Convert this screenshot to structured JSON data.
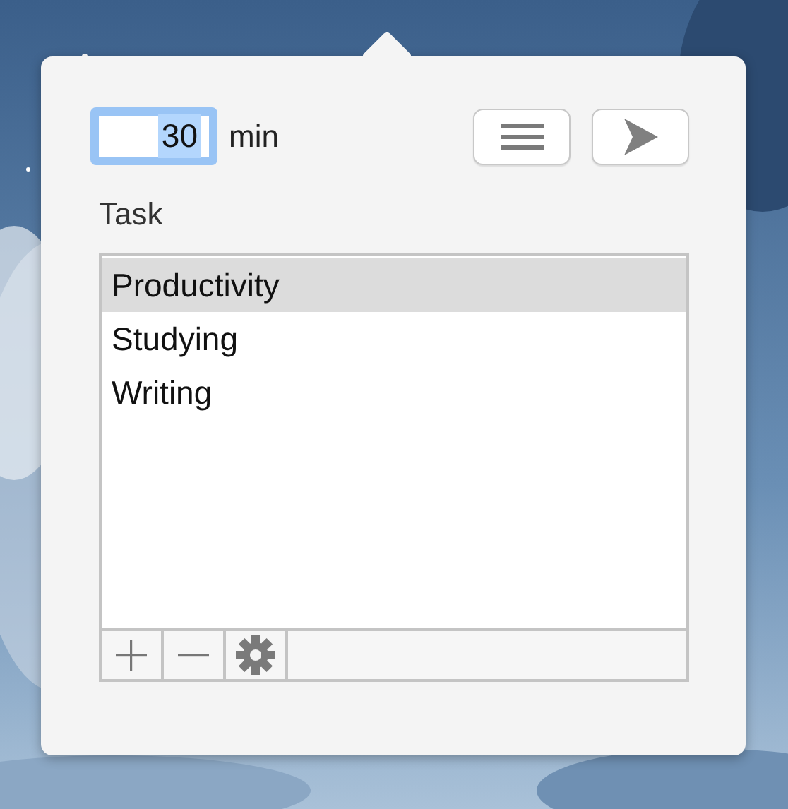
{
  "duration": {
    "value": "30",
    "text_selected": true,
    "unit": "min"
  },
  "task_label": "Task",
  "tasks": [
    {
      "label": "Productivity",
      "selected": true
    },
    {
      "label": "Studying",
      "selected": false
    },
    {
      "label": "Writing",
      "selected": false
    }
  ]
}
